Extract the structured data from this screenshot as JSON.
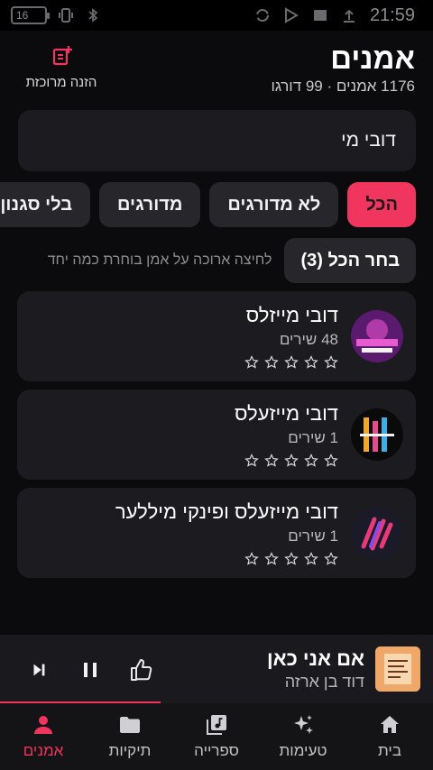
{
  "status_bar": {
    "time": "21:59",
    "battery": "16"
  },
  "header": {
    "title": "אמנים",
    "subtitle": "1176 אמנים · 99 דורגו",
    "rated_feed_label": "הזנה מרוכזת"
  },
  "search": {
    "value": "דובי מי"
  },
  "filters": [
    {
      "label": "הכל",
      "active": true
    },
    {
      "label": "לא מדורגים",
      "active": false
    },
    {
      "label": "מדורגים",
      "active": false
    },
    {
      "label": "בלי סגנון",
      "active": false
    }
  ],
  "selection": {
    "select_all_label": "בחר הכל (3)",
    "hint": "לחיצה ארוכה על אמן בוחרת כמה יחד"
  },
  "artists": [
    {
      "name": "דובי מייזלס",
      "count": "48 שירים",
      "rating": 0
    },
    {
      "name": "דובי מייזעלס",
      "count": "1 שירים",
      "rating": 0
    },
    {
      "name": "דובי מייזעלס ופינקי מיללער",
      "count": "1 שירים",
      "rating": 0
    }
  ],
  "now_playing": {
    "title": "אם אני כאן",
    "artist": "דוד בן ארזה",
    "progress": 0.37
  },
  "bottom_nav": [
    {
      "label": "בית",
      "icon": "home-icon",
      "active": false
    },
    {
      "label": "טעימות",
      "icon": "sparkle-icon",
      "active": false
    },
    {
      "label": "ספרייה",
      "icon": "library-icon",
      "active": false
    },
    {
      "label": "תיקיות",
      "icon": "folder-icon",
      "active": false
    },
    {
      "label": "אמנים",
      "icon": "person-icon",
      "active": true
    }
  ],
  "colors": {
    "accent": "#f0365e",
    "background": "#0b0b0d",
    "card": "#1c1c20"
  }
}
